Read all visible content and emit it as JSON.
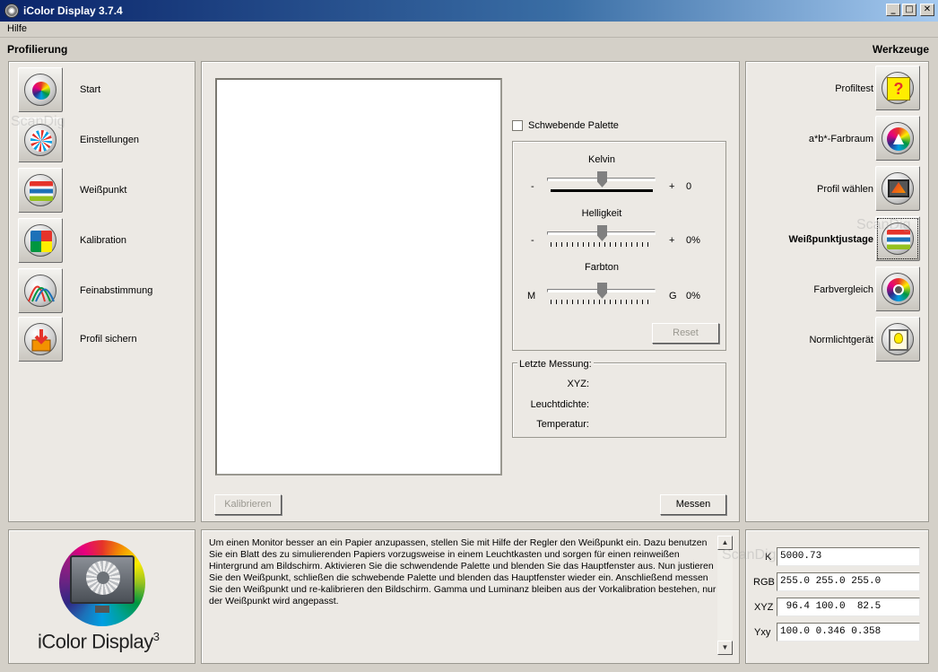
{
  "window": {
    "title": "iColor Display 3.7.4",
    "buttons": {
      "minimize": "_",
      "maximize": "□",
      "close": "✕"
    }
  },
  "menubar": {
    "items": [
      "Hilfe"
    ]
  },
  "left": {
    "heading": "Profilierung",
    "items": [
      {
        "label": "Start",
        "icon": "color-wheel-icon"
      },
      {
        "label": "Einstellungen",
        "icon": "settings-wheel-icon"
      },
      {
        "label": "Weißpunkt",
        "icon": "whitepoint-icon"
      },
      {
        "label": "Kalibration",
        "icon": "calibration-grid-icon"
      },
      {
        "label": "Feinabstimmung",
        "icon": "curves-icon"
      },
      {
        "label": "Profil sichern",
        "icon": "save-profile-icon"
      }
    ]
  },
  "right": {
    "heading": "Werkzeuge",
    "items": [
      {
        "label": "Profiltest",
        "icon": "question-icon"
      },
      {
        "label": "a*b*-Farbraum",
        "icon": "gamut-icon"
      },
      {
        "label": "Profil wählen",
        "icon": "select-profile-icon"
      },
      {
        "label": "Weißpunktjustage",
        "icon": "whitepoint-adjust-icon",
        "active": true
      },
      {
        "label": "Farbvergleich",
        "icon": "compare-icon"
      },
      {
        "label": "Normlichtgerät",
        "icon": "lightbox-icon"
      }
    ]
  },
  "center": {
    "floating_palette_label": "Schwebende Palette",
    "floating_palette_checked": false,
    "sliders": [
      {
        "title": "Kelvin",
        "min": "-",
        "max": "+",
        "value": "0",
        "position": 0.5
      },
      {
        "title": "Helligkeit",
        "min": "-",
        "max": "+",
        "value": "0%",
        "position": 0.5
      },
      {
        "title": "Farbton",
        "min": "M",
        "max": "G",
        "value": "0%",
        "position": 0.5
      }
    ],
    "reset_label": "Reset",
    "last_measurement": {
      "legend": "Letzte Messung:",
      "xyz_label": "XYZ:",
      "luminance_label": "Leuchtdichte:",
      "temperature_label": "Temperatur:"
    },
    "calibrate_label": "Kalibrieren",
    "measure_label": "Messen"
  },
  "bottom": {
    "logo_text": "iColor Display",
    "logo_sup": "3",
    "help_text": "Um einen Monitor besser an ein Papier anzupassen, stellen Sie mit Hilfe der Regler den Weißpunkt ein. Dazu benutzen Sie ein Blatt des zu simulierenden Papiers vorzugsweise in einem Leuchtkasten und sorgen für einen reinweißen Hintergrund am Bildschirm. Aktivieren Sie die schwendende Palette und blenden Sie das Hauptfenster aus. Nun justieren Sie den Weißpunkt, schließen die schwebende Palette und blenden das Hauptfenster wieder ein. Anschließend messen Sie den Weißpunkt und re-kalibrieren den Bildschirm. Gamma und Luminanz bleiben aus der Vorkalibration bestehen, nur der Weißpunkt wird angepasst.",
    "values": [
      {
        "label": "K",
        "value": "5000.73"
      },
      {
        "label": "RGB",
        "value": "255.0 255.0 255.0"
      },
      {
        "label": "XYZ",
        "value": " 96.4 100.0  82.5"
      },
      {
        "label": "Yxy",
        "value": "100.0 0.346 0.358"
      }
    ]
  },
  "watermark": "ScanDig"
}
